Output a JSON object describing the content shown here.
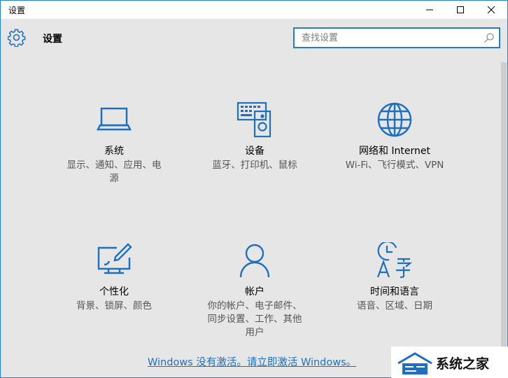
{
  "window": {
    "title": "设置",
    "colors": {
      "accent": "#1f6fbf",
      "border": "#1f80d8",
      "background": "#e6e6e6"
    }
  },
  "header": {
    "title": "设置",
    "search_placeholder": "查找设置"
  },
  "tiles": [
    {
      "icon": "laptop-icon",
      "name": "系统",
      "desc": [
        "显示、通知、应用、电",
        "源"
      ]
    },
    {
      "icon": "keyboard-speaker-icon",
      "name": "设备",
      "desc": [
        "蓝牙、打印机、鼠标"
      ]
    },
    {
      "icon": "globe-icon",
      "name": "网络和 Internet",
      "desc": [
        "Wi-Fi、飞行模式、VPN"
      ]
    },
    {
      "icon": "monitor-brush-icon",
      "name": "个性化",
      "desc": [
        "背景、锁屏、颜色"
      ]
    },
    {
      "icon": "person-icon",
      "name": "帐户",
      "desc": [
        "你的帐户、电子邮件、",
        "同步设置、工作、其他",
        "用户"
      ]
    },
    {
      "icon": "clock-language-icon",
      "name": "时间和语言",
      "desc": [
        "语音、区域、日期"
      ]
    }
  ],
  "activation_link": "Windows 没有激活。请立即激活 Windows。",
  "watermark": {
    "text": "系统之家"
  }
}
